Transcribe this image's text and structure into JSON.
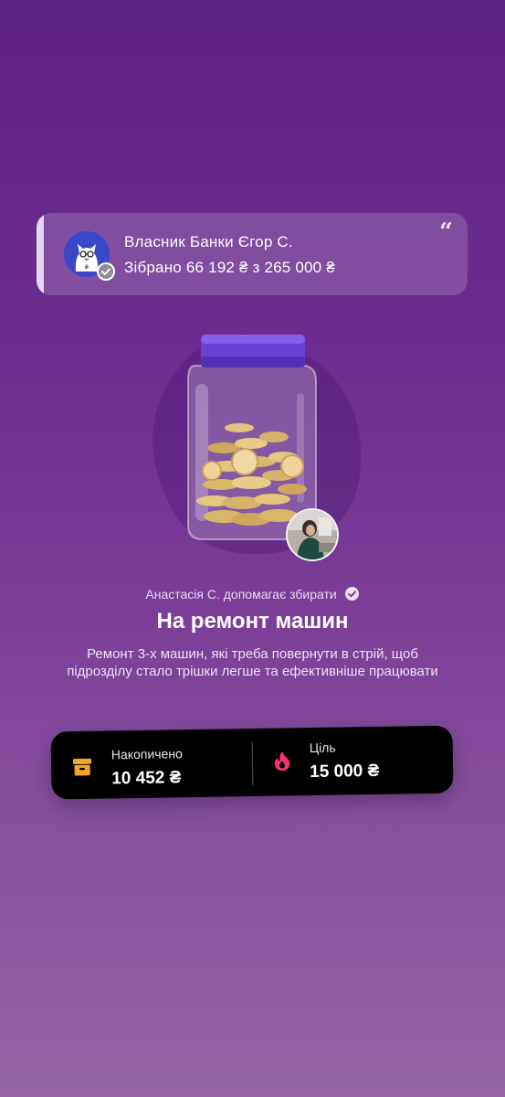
{
  "owner": {
    "name": "Власник Банки Єгор С.",
    "collected": "Зібрано 66 192 ₴ з 265 000 ₴",
    "quote_icon": "quote-icon",
    "verified_icon": "verified-badge-icon"
  },
  "jar": {
    "helper_text": "Анастасія С. допомагає збирати",
    "title": "На ремонт машин",
    "description": "Ремонт 3-х машин, які треба повернути в стрій, щоб підрозділу стало трішки легше та ефективніше працювати"
  },
  "stats": {
    "saved_label": "Накопичено",
    "saved_value": "10 452 ₴",
    "saved_icon": "box-icon",
    "goal_label": "Ціль",
    "goal_value": "15 000 ₴",
    "goal_icon": "flame-icon"
  },
  "colors": {
    "background_top": "#5e2387",
    "background_bottom": "#9566a3",
    "lid": "#6a3fd6",
    "box_icon": "#f5a524",
    "flame_icon": "#ff2e7a"
  }
}
